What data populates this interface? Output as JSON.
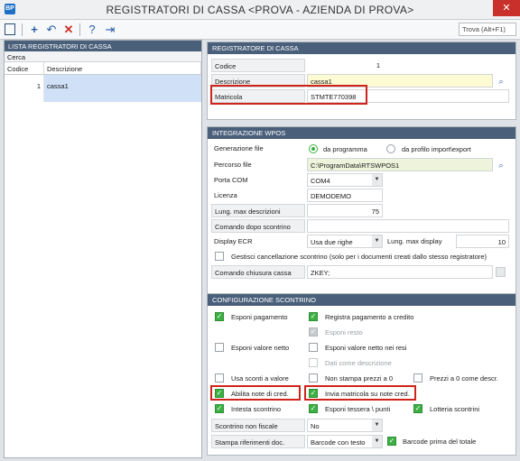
{
  "window": {
    "title": "REGISTRATORI DI CASSA <PROVA - AZIENDA DI PROVA>",
    "app_icon": "BP",
    "close": "✕"
  },
  "toolbar": {
    "find_placeholder": "Trova (Alt+F1)"
  },
  "list": {
    "header": "LISTA REGISTRATORI DI CASSA",
    "search_label": "Cerca",
    "columns": [
      "Codice",
      "Descrizione"
    ],
    "rows": [
      {
        "code": "1",
        "desc": "cassa1"
      }
    ]
  },
  "registratore": {
    "header": "REGISTRATORE DI CASSA",
    "codice_label": "Codice",
    "codice": "1",
    "descrizione_label": "Descrizione",
    "descrizione": "cassa1",
    "matricola_label": "Matricola",
    "matricola": "STMTE770398"
  },
  "wpos": {
    "header": "INTEGRAZIONE WPOS",
    "generazione_label": "Generazione file",
    "opt_programma": "da programma",
    "opt_profilo": "da profilo import\\export",
    "percorso_label": "Percorso file",
    "percorso": "C:\\ProgramData\\RTSWPOS1",
    "porta_label": "Porta COM",
    "porta": "COM4",
    "licenza_label": "Licenza",
    "licenza": "DEMODEMO",
    "lung_desc_label": "Lung. max descrizioni",
    "lung_desc": "75",
    "comando_dopo_label": "Comando dopo scontrino",
    "comando_dopo": "",
    "display_label": "Display ECR",
    "display": "Usa due righe",
    "lung_display_label": "Lung. max display",
    "lung_display": "10",
    "gestisci_label": "Gestisci cancellazione scontrino (solo per i documenti creati dallo stesso registratore)",
    "chiusura_label": "Comando chiusura cassa",
    "chiusura": "ZKEY;"
  },
  "config": {
    "header": "CONFIGURAZIONE SCONTRINO",
    "esponi_pagamento": "Esponi pagamento",
    "registra_credito": "Registra pagamento a credito",
    "esponi_resto": "Esponi resto",
    "esponi_netto": "Esponi valore netto",
    "esponi_netto_resi": "Esponi valore netto nei resi",
    "dati_descrizione": "Dati come descrizione",
    "usa_sconti": "Usa sconti a valore",
    "non_stampa": "Non stampa prezzi a 0",
    "prezzi_zero": "Prezzi a 0 come descr.",
    "abilita_note": "Abilita note di cred.",
    "invia_matricola": "Invia matricola su note cred.",
    "intesta": "Intesta scontrino",
    "esponi_tessera": "Esponi tessera \\ punti",
    "lotteria": "Lotteria scontrini",
    "non_fiscale_label": "Scontrino non fiscale",
    "non_fiscale": "No",
    "stampa_rif_label": "Stampa riferimenti doc.",
    "stampa_rif": "Barcode con testo",
    "barcode_prima": "Barcode prima del totale"
  },
  "colors": {
    "accent": "#4a5f7a",
    "check": "#3cb043",
    "highlight": "#d0231b"
  }
}
